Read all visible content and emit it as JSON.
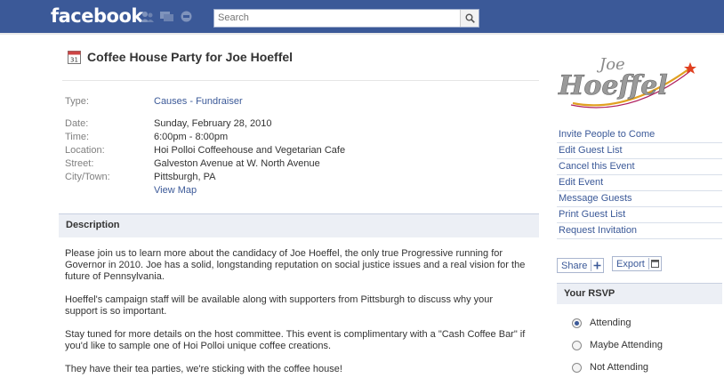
{
  "header": {
    "logo": "facebook",
    "search_placeholder": "Search",
    "icons": [
      "friend-requests-icon",
      "messages-icon",
      "notifications-icon",
      "search-icon"
    ]
  },
  "event": {
    "title": "Coffee House Party for Joe Hoeffel",
    "type_label": "Type:",
    "type_value": "Causes - Fundraiser",
    "date_label": "Date:",
    "date_value": "Sunday, February 28, 2010",
    "time_label": "Time:",
    "time_value": "6:00pm - 8:00pm",
    "location_label": "Location:",
    "location_value": "Hoi Polloi Coffeehouse and Vegetarian Cafe",
    "street_label": "Street:",
    "street_value": "Galveston Avenue at W. North Avenue",
    "city_label": "City/Town:",
    "city_value": "Pittsburgh, PA",
    "view_map": "View Map"
  },
  "description": {
    "heading": "Description",
    "p1": "Please join us to learn more about the candidacy of Joe Hoeffel, the only true Progressive running for Governor in 2010. Joe has a solid, longstanding reputation on social justice issues and a real vision for the future of Pennsylvania.",
    "p2": "Hoeffel's campaign staff will be available along with supporters from Pittsburgh to discuss why your support is so important.",
    "p3": "Stay tuned for more details on the host committee. This event is complimentary with a \"Cash Coffee Bar\" if you'd like to sample one of Hoi Polloi unique coffee creations.",
    "p4": "They have their tea parties, we're sticking with the coffee house!"
  },
  "sidebar": {
    "logo_text": "Joe Hoeffel",
    "actions": [
      "Invite People to Come",
      "Edit Guest List",
      "Cancel this Event",
      "Edit Event",
      "Message Guests",
      "Print Guest List",
      "Request Invitation"
    ],
    "share": "Share",
    "export": "Export",
    "rsvp_heading": "Your RSVP",
    "rsvp_options": [
      "Attending",
      "Maybe Attending",
      "Not Attending"
    ],
    "rsvp_selected": "Attending"
  },
  "colors": {
    "brand": "#3b5998",
    "link": "#3b5998",
    "header_bg": "#eceff5"
  }
}
